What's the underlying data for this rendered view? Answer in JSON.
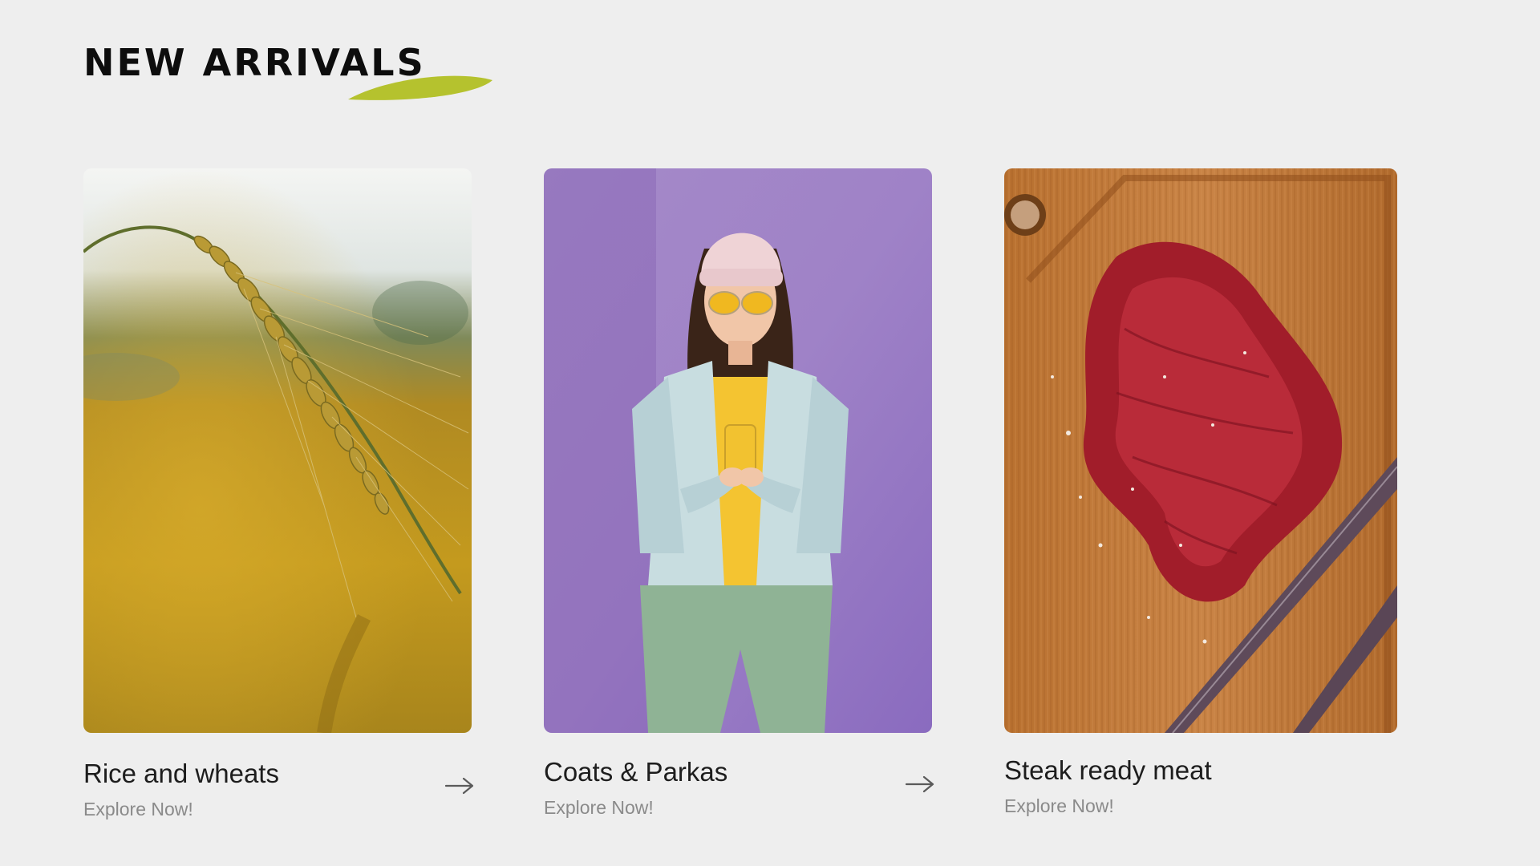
{
  "section": {
    "title": "NEW ARRIVALS",
    "accent_color": "#b5c22e"
  },
  "cards": [
    {
      "title": "Rice and wheats",
      "cta": "Explore Now!",
      "image": "wheat-photo",
      "arrow_icon": "arrow-right-icon"
    },
    {
      "title": "Coats & Parkas",
      "cta": "Explore Now!",
      "image": "woman-in-jacket-photo",
      "arrow_icon": "arrow-right-icon"
    },
    {
      "title": "Steak ready meat",
      "cta": "Explore Now!",
      "image": "steak-on-cutting-board-photo"
    }
  ]
}
